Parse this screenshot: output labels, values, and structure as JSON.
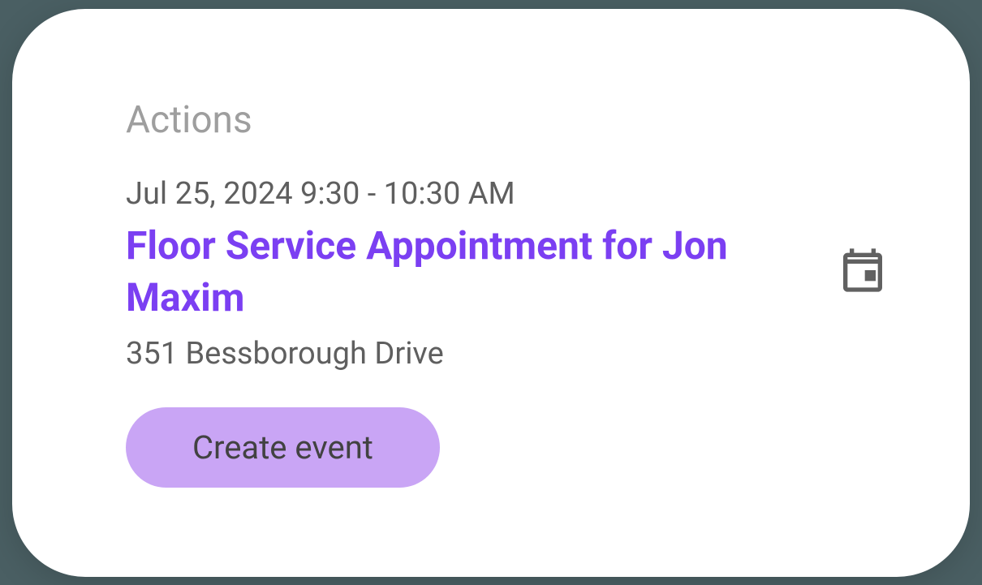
{
  "section": {
    "label": "Actions"
  },
  "event": {
    "datetime": "Jul 25, 2024 9:30 - 10:30 AM",
    "title": "Floor Service Appointment for Jon Maxim",
    "location": "351 Bessborough Drive"
  },
  "button": {
    "create_label": "Create event"
  }
}
